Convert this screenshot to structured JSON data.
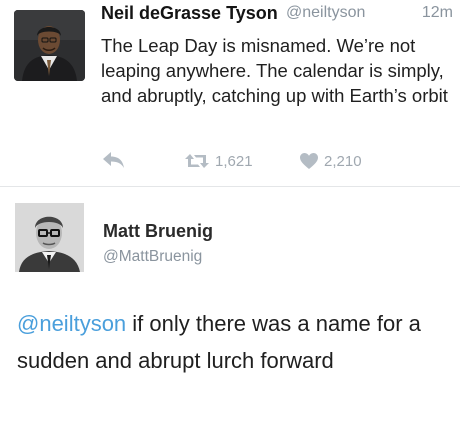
{
  "tweet": {
    "author_name": "Neil deGrasse Tyson",
    "author_handle": "@neiltyson",
    "time": "12m",
    "text": "The Leap Day is misnamed. We’re not leaping anywhere. The calendar is simply, and abruptly, catching up with Earth’s orbit",
    "actions": {
      "reply_icon": "reply-arrow-icon",
      "retweet_icon": "retweet-icon",
      "retweet_count": "1,621",
      "like_icon": "heart-icon",
      "like_count": "2,210"
    }
  },
  "reply": {
    "author_name": "Matt Bruenig",
    "author_handle": "@MattBruenig",
    "mention": "@neiltyson",
    "text": " if only there was a name for a sudden and abrupt lurch forward"
  },
  "colors": {
    "mention": "#4a9fdc",
    "muted": "#8a949e",
    "action_icon": "#b4bcc4"
  }
}
